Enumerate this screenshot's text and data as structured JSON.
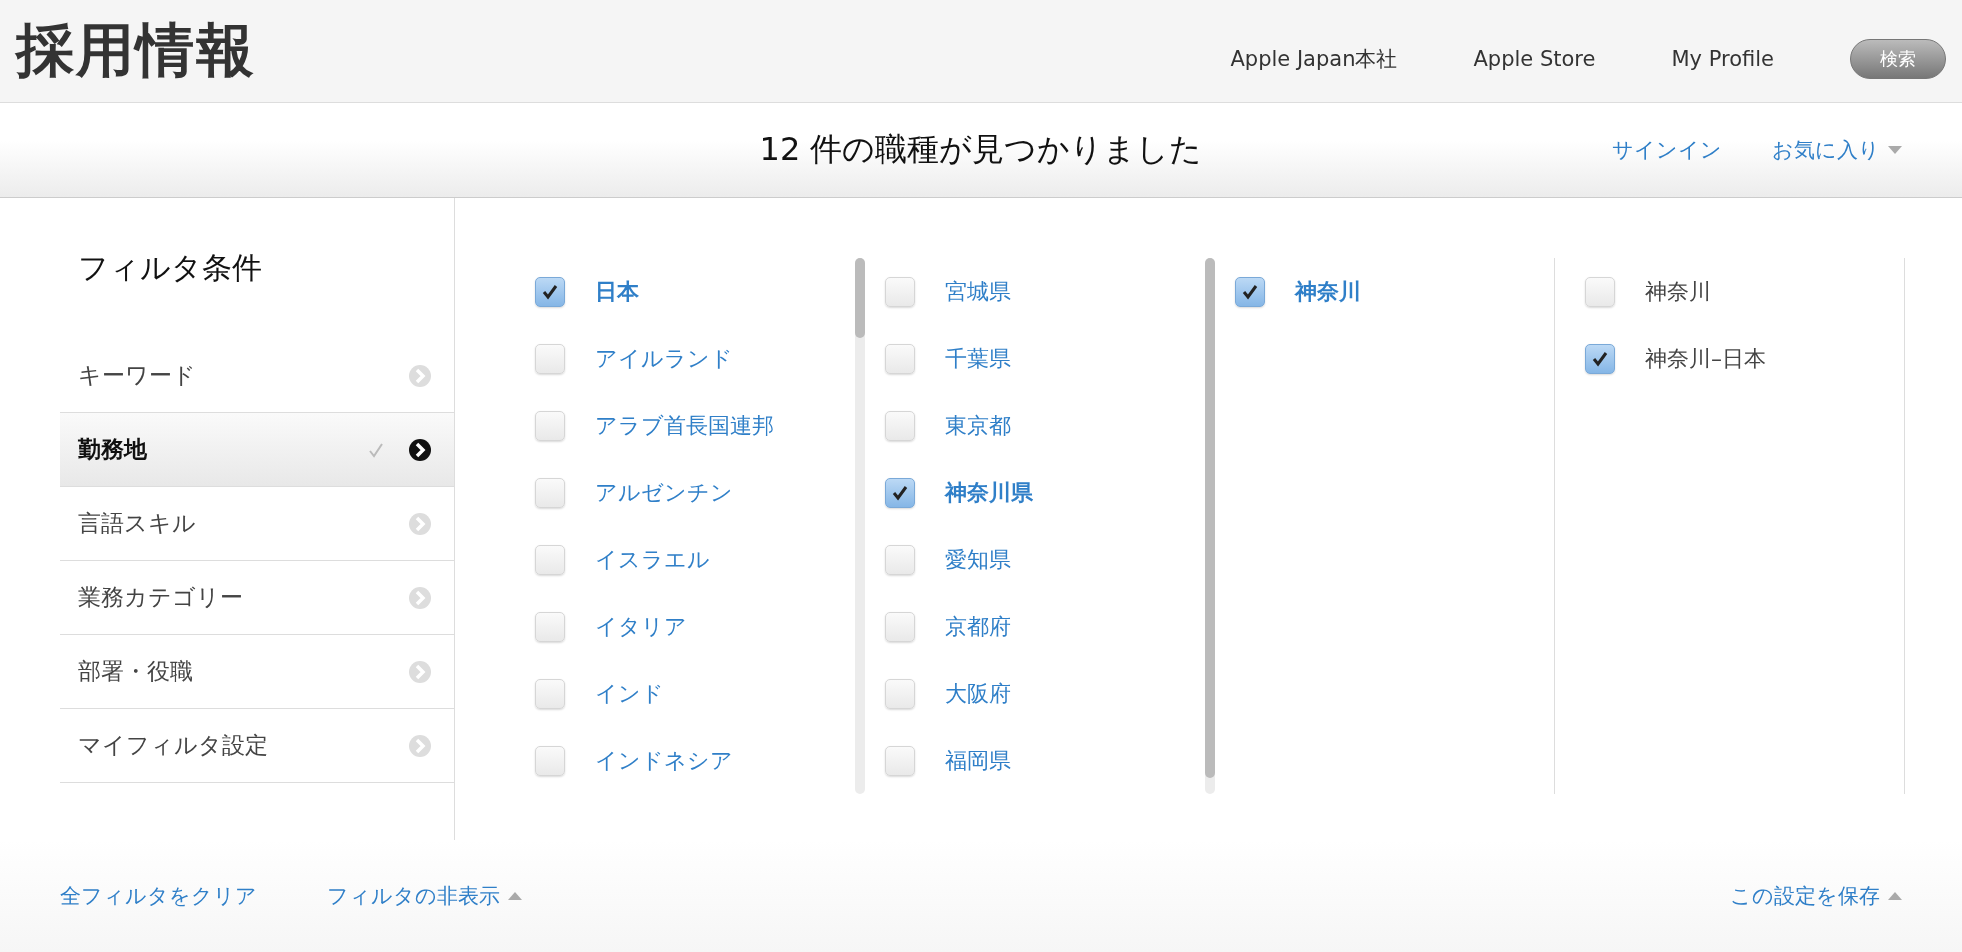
{
  "header": {
    "title": "採用情報",
    "nav": [
      "Apple Japan本社",
      "Apple Store",
      "My Profile"
    ],
    "search_button": "検索"
  },
  "results_bar": {
    "title": "12 件の職種が見つかりました",
    "sign_in": "サインイン",
    "favorites": "お気に入り"
  },
  "sidebar": {
    "title": "フィルタ条件",
    "items": [
      {
        "label": "キーワード",
        "selected": false,
        "applied": false
      },
      {
        "label": "勤務地",
        "selected": true,
        "applied": true
      },
      {
        "label": "言語スキル",
        "selected": false,
        "applied": false
      },
      {
        "label": "業務カテゴリー",
        "selected": false,
        "applied": false
      },
      {
        "label": "部署・役職",
        "selected": false,
        "applied": false
      },
      {
        "label": "マイフィルタ設定",
        "selected": false,
        "applied": false
      }
    ]
  },
  "columns": [
    {
      "kind": "link",
      "items": [
        {
          "label": "日本",
          "checked": true
        },
        {
          "label": "アイルランド",
          "checked": false
        },
        {
          "label": "アラブ首長国連邦",
          "checked": false
        },
        {
          "label": "アルゼンチン",
          "checked": false
        },
        {
          "label": "イスラエル",
          "checked": false
        },
        {
          "label": "イタリア",
          "checked": false
        },
        {
          "label": "インド",
          "checked": false
        },
        {
          "label": "インドネシア",
          "checked": false
        }
      ]
    },
    {
      "kind": "link",
      "items": [
        {
          "label": "宮城県",
          "checked": false
        },
        {
          "label": "千葉県",
          "checked": false
        },
        {
          "label": "東京都",
          "checked": false
        },
        {
          "label": "神奈川県",
          "checked": true
        },
        {
          "label": "愛知県",
          "checked": false
        },
        {
          "label": "京都府",
          "checked": false
        },
        {
          "label": "大阪府",
          "checked": false
        },
        {
          "label": "福岡県",
          "checked": false
        }
      ]
    },
    {
      "kind": "link",
      "items": [
        {
          "label": "神奈川",
          "checked": true
        }
      ]
    },
    {
      "kind": "plain",
      "items": [
        {
          "label": "神奈川",
          "checked": false
        },
        {
          "label": "神奈川–日本",
          "checked": true
        }
      ]
    }
  ],
  "footer": {
    "clear": "全フィルタをクリア",
    "hide": "フィルタの非表示",
    "save": "この設定を保存"
  }
}
